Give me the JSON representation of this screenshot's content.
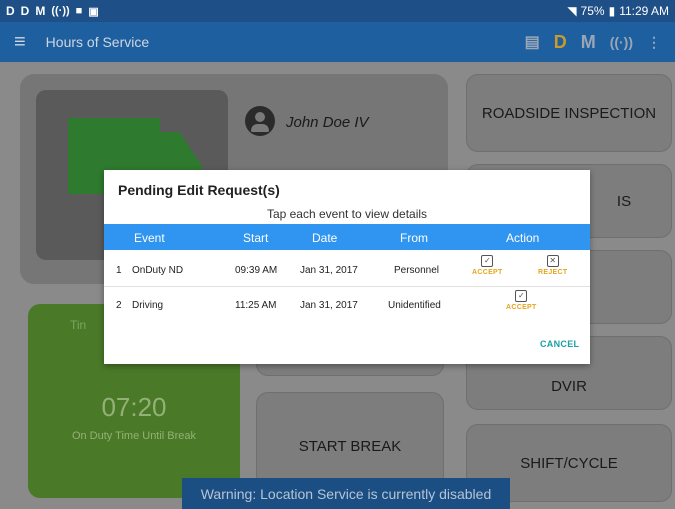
{
  "status_bar": {
    "left_icons": [
      "D",
      "D",
      "M",
      "((·))",
      "■",
      "▣"
    ],
    "battery": "75%",
    "time": "11:29 AM"
  },
  "app_bar": {
    "title": "Hours of Service",
    "action_d": "D",
    "action_m": "M"
  },
  "driver": {
    "name": "John Doe IV"
  },
  "timer": {
    "peek_label": "Tin",
    "value": "07:20",
    "label": "On Duty Time Until Break"
  },
  "buttons": {
    "roadside": "ROADSIDE INSPECTION",
    "peek_right": "IS",
    "dvir": "DVIR",
    "start_break": "START BREAK",
    "shift_cycle": "SHIFT/CYCLE"
  },
  "dialog": {
    "title": "Pending Edit Request(s)",
    "subtitle": "Tap each event to view details",
    "columns": [
      "Event",
      "Start",
      "Date",
      "From",
      "Action"
    ],
    "rows": [
      {
        "num": "1",
        "event": "OnDuty ND",
        "start": "09:39 AM",
        "date": "Jan 31, 2017",
        "from": "Personnel",
        "actions": [
          "ACCEPT",
          "REJECT"
        ]
      },
      {
        "num": "2",
        "event": "Driving",
        "start": "11:25 AM",
        "date": "Jan 31, 2017",
        "from": "Unidentified",
        "actions": [
          "ACCEPT"
        ]
      }
    ],
    "cancel": "CANCEL"
  },
  "warning": "Warning: Location Service is currently disabled"
}
